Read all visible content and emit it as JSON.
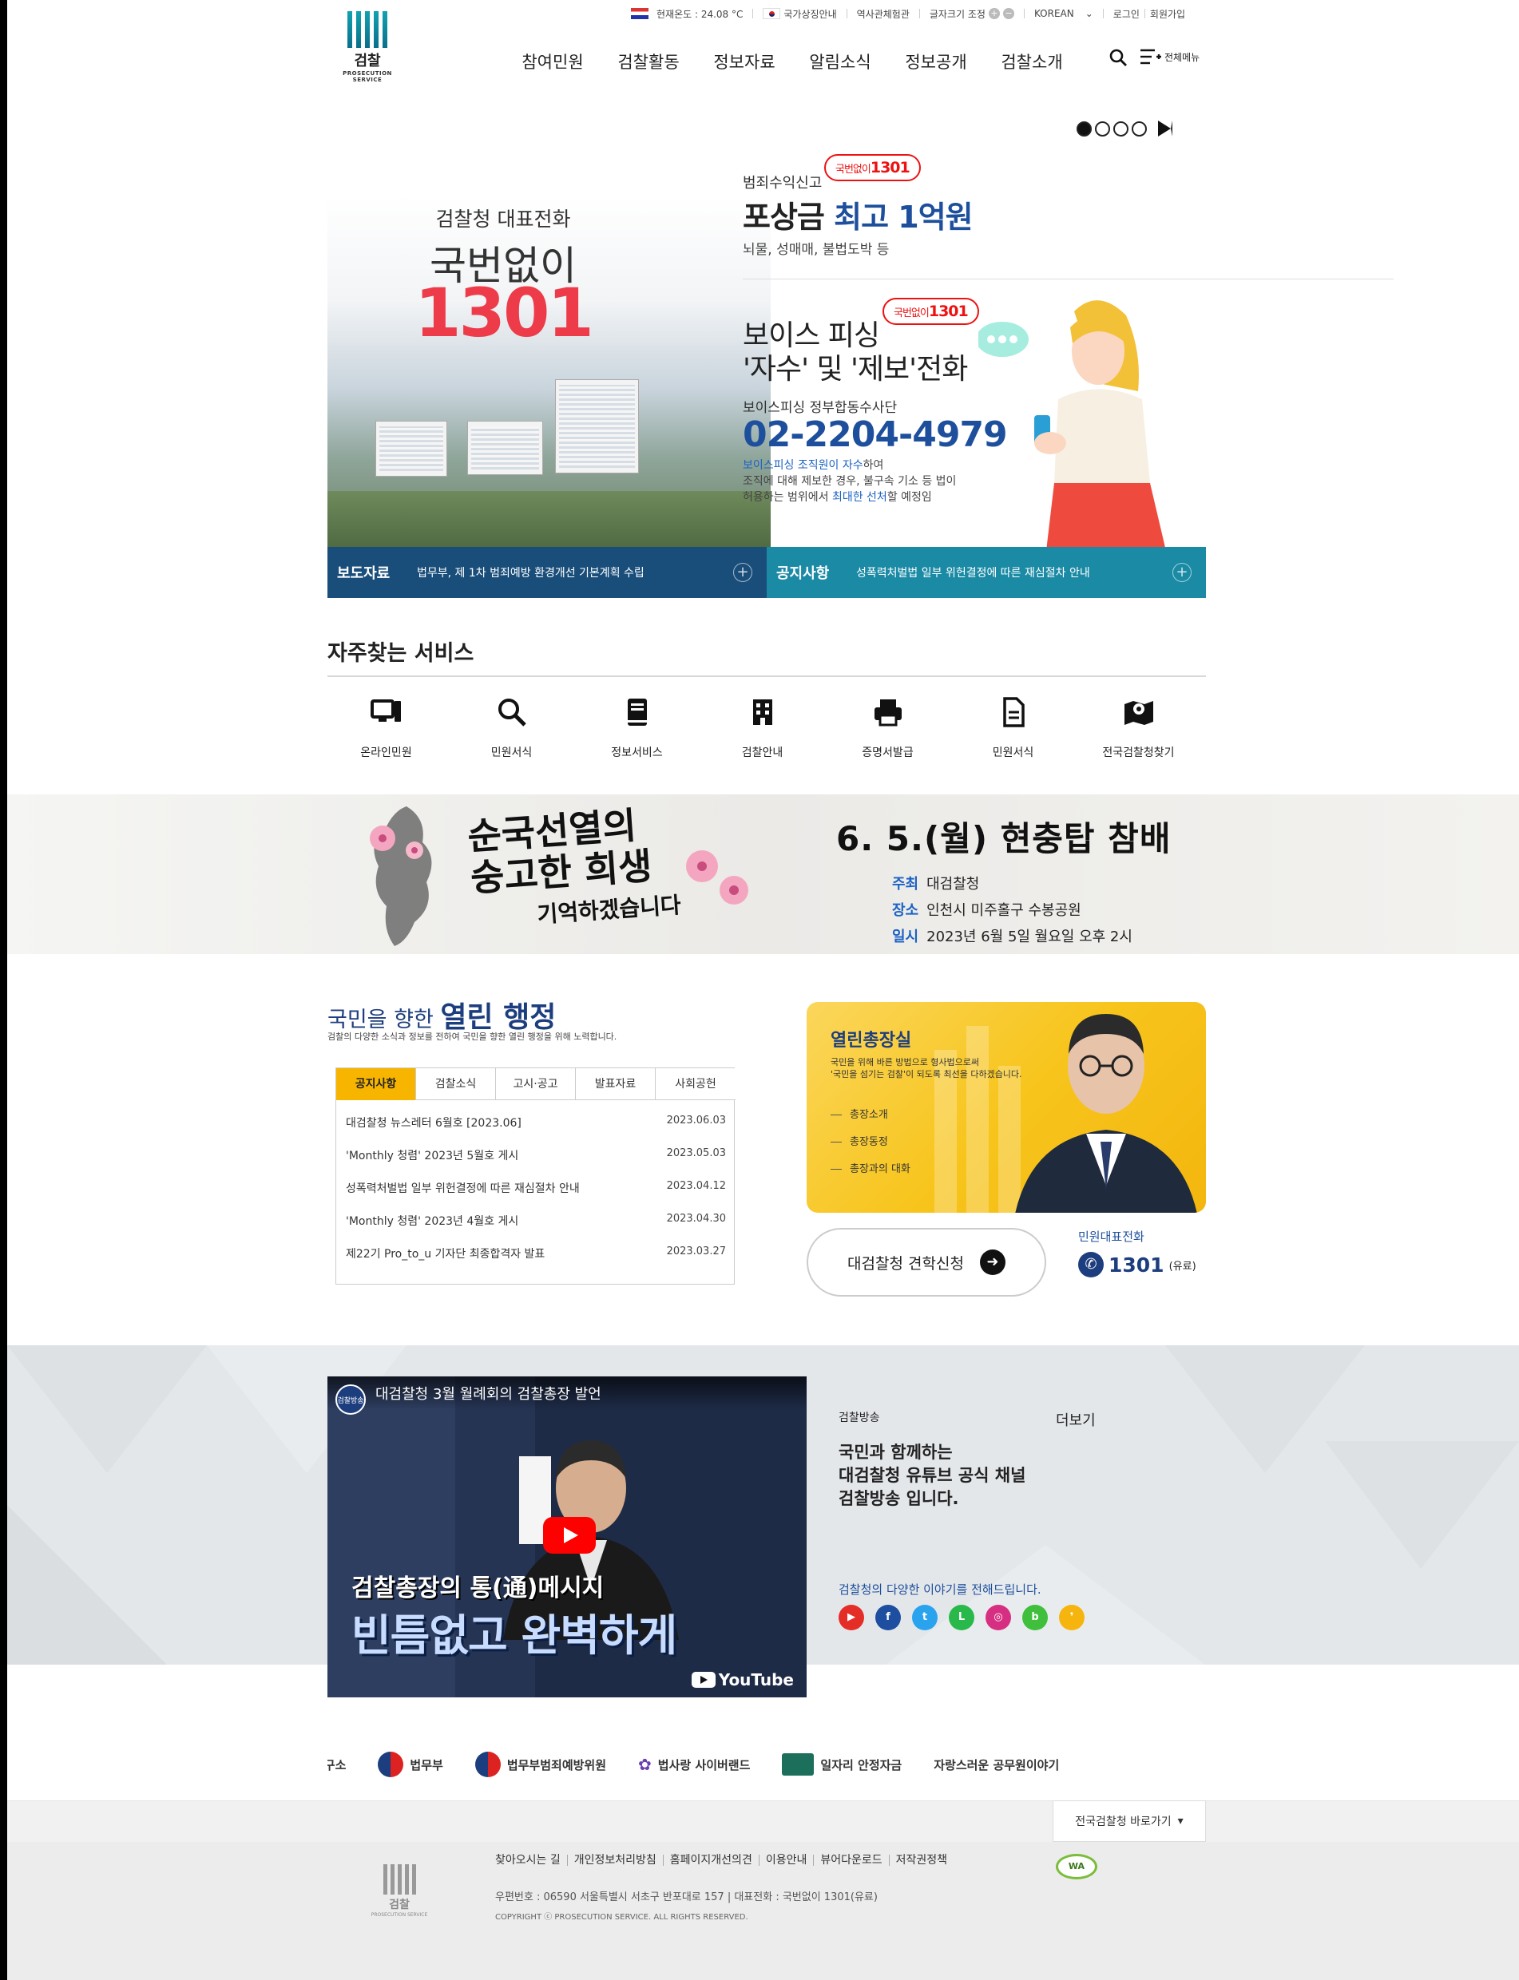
{
  "utility": {
    "temperature": "현재온도 : 24.08 °C",
    "links": [
      "국가상징안내",
      "역사관체험관",
      "글자크기 조정"
    ],
    "zoom_in": "+",
    "zoom_out": "−",
    "language": "KOREAN",
    "login": "로그인",
    "signup": "회원가입"
  },
  "logo": {
    "name": "검찰",
    "sub": "PROSECUTION SERVICE"
  },
  "gnb": [
    "참여민원",
    "검찰활동",
    "정보자료",
    "알림소식",
    "정보공개",
    "검찰소개"
  ],
  "allmenu_label": "전체메뉴",
  "hero": {
    "left_caption": "검찰청 대표전화",
    "left_title": "국번없이",
    "left_number": "1301",
    "promo1_small": "범죄수익신고",
    "promo1_title_a": "포상금 ",
    "promo1_title_b": "최고 1억원",
    "promo1_desc": "뇌물, 성매매, 불법도박 등",
    "bubble_prefix": "국번없이",
    "bubble_number": "1301",
    "promo2_line1": "보이스 피싱",
    "promo2_line2": "'자수' 및 '제보'전화",
    "promo2_sub": "보이스피싱 정부합동수사단",
    "promo2_tel": "02-2204-4979",
    "promo2_desc1a": "보이스피싱 조직원이 자수",
    "promo2_desc1b": "하여",
    "promo2_desc2": "조직에 대해 제보한 경우, 불구속 기소 등 법이",
    "promo2_desc3a": "허용하는 범위에서 ",
    "promo2_desc3b": "최대한 선처",
    "promo2_desc3c": "할 예정임"
  },
  "newsbar": [
    {
      "title": "보도자료",
      "text": "법무부, 제 1차 범죄예방 환경개선 기본계획 수립"
    },
    {
      "title": "공지사항",
      "text": "성폭력처벌법 일부 위헌결정에 따른 재심절차 안내"
    }
  ],
  "services": {
    "title": "자주찾는 서비스",
    "items": [
      {
        "label": "온라인민원",
        "icon": "computer-icon"
      },
      {
        "label": "민원서식",
        "icon": "search-icon"
      },
      {
        "label": "정보서비스",
        "icon": "book-icon"
      },
      {
        "label": "검찰안내",
        "icon": "building-icon"
      },
      {
        "label": "증명서발급",
        "icon": "printer-icon"
      },
      {
        "label": "민원서식",
        "icon": "document-icon"
      },
      {
        "label": "전국검찰청찾기",
        "icon": "map-icon"
      }
    ]
  },
  "banner": {
    "calligraphy_line1": "순국선열의",
    "calligraphy_line2": "숭고한 희생",
    "calligraphy_line3": "기억하겠습니다",
    "title": "6. 5.(월) 현충탑 참배",
    "rows": [
      {
        "key": "주최",
        "value": "대검찰청"
      },
      {
        "key": "장소",
        "value": "인천시 미주홀구 수봉공원"
      },
      {
        "key": "일시",
        "value": "2023년 6월 5일 월요일 오후 2시"
      }
    ]
  },
  "open_admin": {
    "title_a": "국민을 향한 ",
    "title_b": "열린 행정",
    "subtitle": "검찰의 다양한 소식과 정보를 전하여 국민을 향한 열린 행정을 위해 노력합니다.",
    "tabs": [
      "공지사항",
      "검찰소식",
      "고시·공고",
      "발표자료",
      "사회공헌"
    ],
    "list": [
      {
        "title": "대검찰청 뉴스레터 6월호 [2023.06]",
        "date": "2023.06.03"
      },
      {
        "title": "'Monthly 청렴' 2023년 5월호 게시",
        "date": "2023.05.03"
      },
      {
        "title": "성폭력처벌법 일부 위헌결정에 따른 재심절차 안내",
        "date": "2023.04.12"
      },
      {
        "title": "'Monthly 청렴' 2023년 4월호 게시",
        "date": "2023.04.30"
      },
      {
        "title": "제22기 Pro_to_u 기자단 최종합격자 발표",
        "date": "2023.03.27"
      }
    ]
  },
  "chief": {
    "title": "열린총장실",
    "desc1": "국민을 위해 바른 방법으로 형사법으로써",
    "desc2": "'국민을 섬기는 검찰'이 되도록 최선을 다하겠습니다.",
    "links": [
      "총장소개",
      "총장동정",
      "총장과의 대화"
    ]
  },
  "visit": {
    "label": "대검찰청 견학신청",
    "arrow": "➜"
  },
  "tel": {
    "label": "민원대표전화",
    "number": "1301",
    "note": "(유료)"
  },
  "broadcast": {
    "video_title": "대검찰청 3월 월례회의 검찰총장 발언",
    "video_channel": "검찰방송",
    "video_caption1": "검찰총장의 통(通)메시지",
    "video_caption2": "빈틈없고 완벽하게",
    "youtube": "YouTube",
    "label": "검찰방송",
    "more": "더보기",
    "line1": "국민과 함께하는",
    "line2": "대검찰청 유튜브 공식 채널",
    "line3": "검찰방송 입니다.",
    "desc": "검찰청의 다양한 이야기를 전해드립니다.",
    "sns": [
      {
        "name": "youtube-icon",
        "glyph": "▶",
        "color": "#e52d27"
      },
      {
        "name": "facebook-icon",
        "glyph": "f",
        "color": "#1d4ea0"
      },
      {
        "name": "twitter-icon",
        "glyph": "t",
        "color": "#2aa3ef"
      },
      {
        "name": "line-icon",
        "glyph": "L",
        "color": "#29b84a"
      },
      {
        "name": "instagram-icon",
        "glyph": "◎",
        "color": "#d62f82"
      },
      {
        "name": "band-icon",
        "glyph": "b",
        "color": "#3fbf3b"
      },
      {
        "name": "kakaostory-icon",
        "glyph": "❜",
        "color": "#f6b50e"
      }
    ]
  },
  "partners": [
    "연구소",
    "법무부",
    "법무부범죄예방위원",
    "법사랑 사이버랜드",
    "일자리 안정자금",
    "자랑스러운 공무원이야기"
  ],
  "footer": {
    "select_label": "전국검찰청 바로가기",
    "links": [
      "찾아오시는 길",
      "개인정보처리방침",
      "홈페이지개선의견",
      "이용안내",
      "뷰어다운로드",
      "저작권정책"
    ],
    "address": "우편번호 : 06590 서울특별시 서초구 반포대로 157 | 대표전화 : 국번없이 1301(유료)",
    "copyright": "COPYRIGHT ⓒ PROSECUTION SERVICE. ALL RIGHTS RESERVED.",
    "wa_mark": "WA"
  }
}
